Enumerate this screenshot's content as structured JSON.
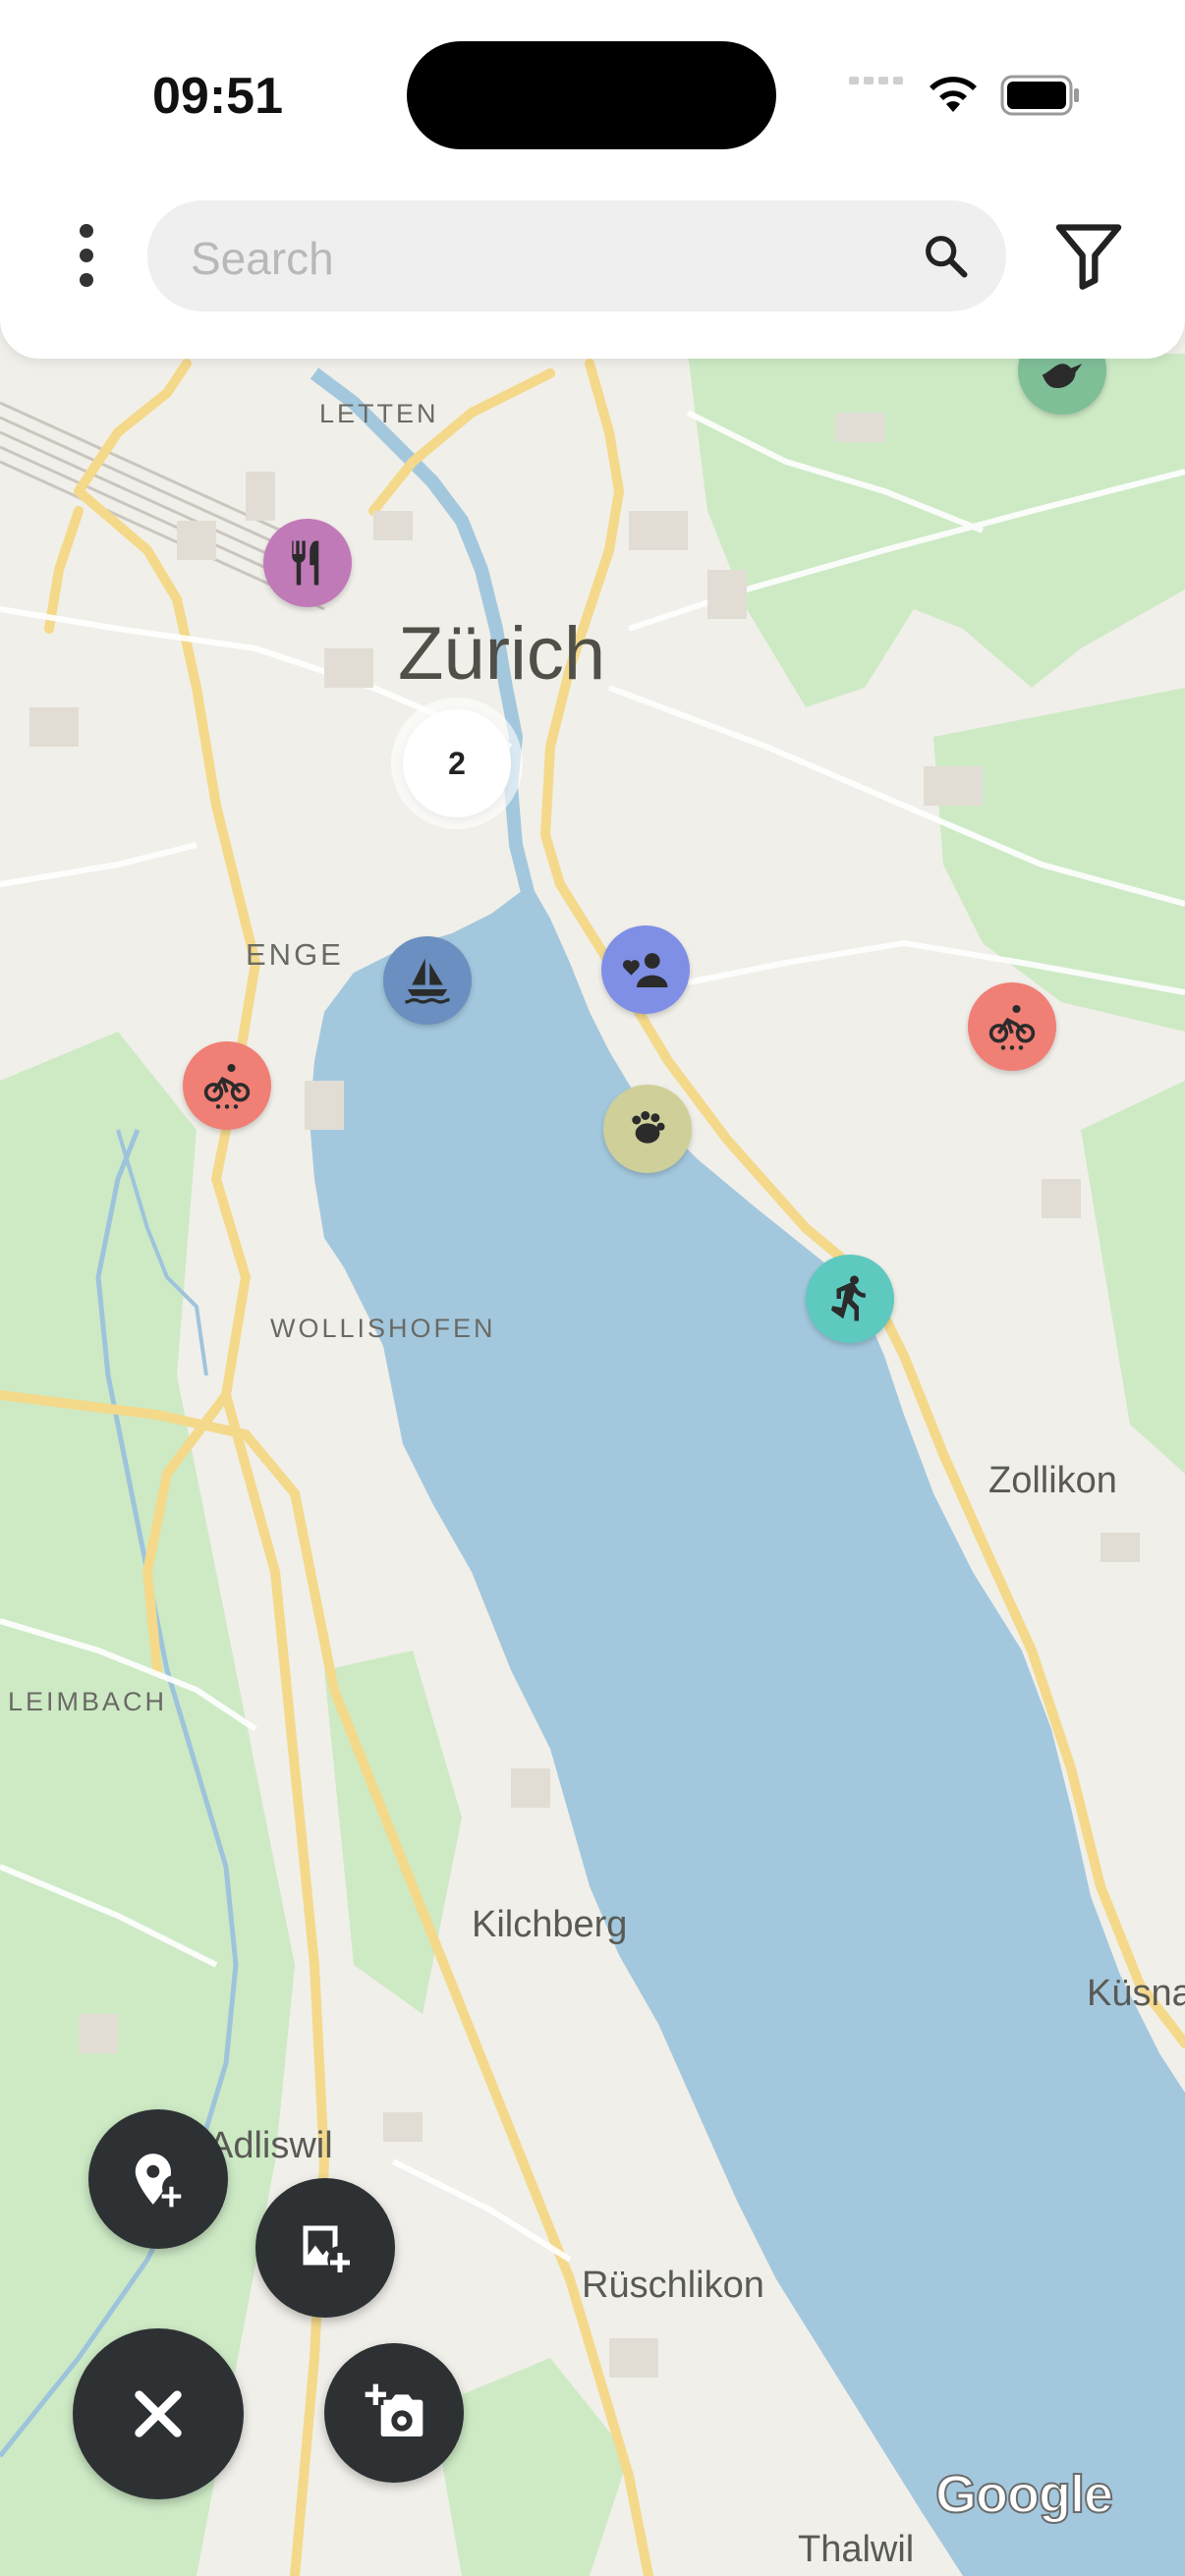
{
  "status_bar": {
    "time": "09:51"
  },
  "search": {
    "placeholder": "Search"
  },
  "cluster": {
    "count": "2"
  },
  "map": {
    "labels": {
      "letten": "LETTEN",
      "zurich": "Zürich",
      "enge": "ENGE",
      "wollishofen": "WOLLISHOFEN",
      "zollikon": "Zollikon",
      "leimbach": "LEIMBACH",
      "kilchberg": "Kilchberg",
      "kusnacht": "Küsna",
      "adliswil": "Adliswil",
      "ruschlikon": "Rüschlikon",
      "thalwil": "Thalwil"
    },
    "attribution": "Google"
  },
  "markers": [
    {
      "name": "restaurant-marker",
      "icon": "restaurant-icon",
      "color": "#c17ab8"
    },
    {
      "name": "sailing-marker",
      "icon": "sailboat-icon",
      "color": "#6a8fc0"
    },
    {
      "name": "social-marker",
      "icon": "volunteer-person-icon",
      "color": "#7f8fe6"
    },
    {
      "name": "cycling-marker-west",
      "icon": "bicycle-icon",
      "color": "#f07f76"
    },
    {
      "name": "cycling-marker-east",
      "icon": "bicycle-icon",
      "color": "#f07f76"
    },
    {
      "name": "pets-marker",
      "icon": "pets-icon",
      "color": "#cfcf9a"
    },
    {
      "name": "running-marker",
      "icon": "running-icon",
      "color": "#5ec9bf"
    },
    {
      "name": "bird-marker",
      "icon": "bird-icon",
      "color": "#7fbf98"
    }
  ],
  "colors": {
    "water": "#a3c8de",
    "park": "#cdeac5",
    "road": "#f4d98a",
    "land": "#f1efe9",
    "fab": "#2d3134"
  }
}
